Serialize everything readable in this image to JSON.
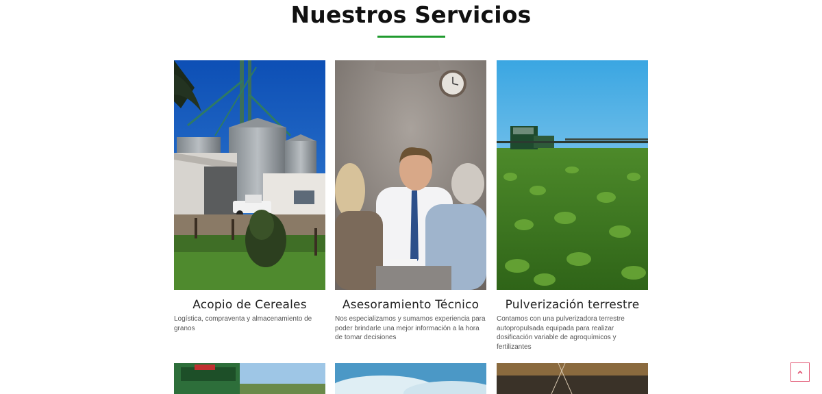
{
  "section": {
    "title": "Nuestros Servicios",
    "accent_color": "#1f9a2e"
  },
  "services": [
    {
      "title": "Acopio de Cereales",
      "description": "Logística, compraventa y almacenamiento de granos",
      "image": "grain-silos-photo"
    },
    {
      "title": "Asesoramiento Técnico",
      "description": "Nos especializamos y sumamos experiencia para poder brindarle una mejor información a la hora de tomar decisiones",
      "image": "business-meeting-photo"
    },
    {
      "title": "Pulverización terrestre",
      "description": "Contamos con una pulverizadora terrestre autopropulsada equipada para realizar dosificación variable de agroquímicos y fertilizantes",
      "image": "crop-sprayer-field-photo"
    }
  ],
  "next_row_images": [
    "green-machinery-photo",
    "sky-clouds-photo",
    "sunset-field-photo"
  ],
  "scroll_top": {
    "icon": "chevron-up-icon",
    "border_color": "#e0506e"
  }
}
